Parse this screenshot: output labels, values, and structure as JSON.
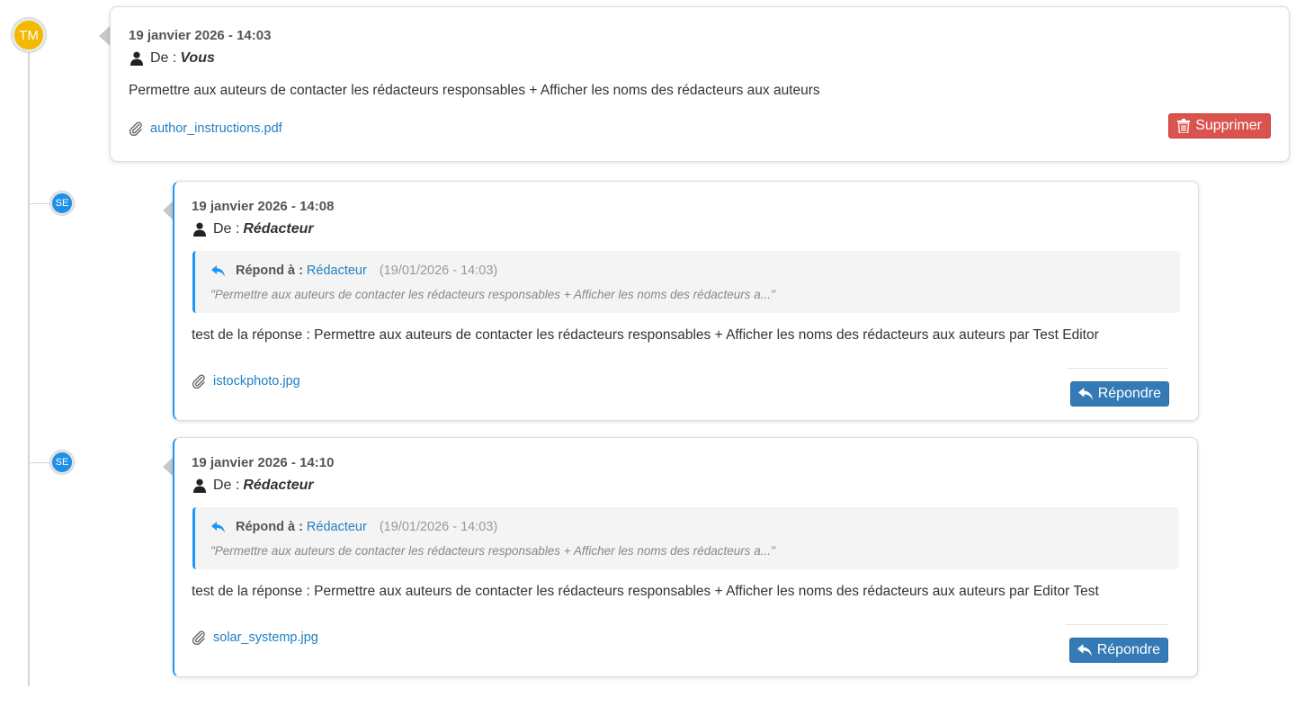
{
  "thread": {
    "main": {
      "avatar_initials": "TM",
      "date": "19 janvier 2026 - 14:03",
      "from_label": "De :",
      "from_name": "Vous",
      "message": "Permettre aux auteurs de contacter les rédacteurs responsables + Afficher les noms des rédacteurs aux auteurs",
      "attachment": "author_instructions.pdf",
      "delete_label": "Supprimer"
    },
    "replies": [
      {
        "avatar_initials": "SE",
        "date": "19 janvier 2026 - 14:08",
        "from_label": "De :",
        "from_name": "Rédacteur",
        "quote_label": "Répond à :",
        "quote_author": "Rédacteur",
        "quote_date": "(19/01/2026 - 14:03)",
        "quote_text": "\"Permettre aux auteurs de contacter les rédacteurs responsables + Afficher les noms des rédacteurs a...\"",
        "message": "test de la réponse : Permettre aux auteurs de contacter les rédacteurs responsables + Afficher les noms des rédacteurs aux auteurs par Test Editor",
        "attachment": "istockphoto.jpg",
        "reply_label": "Répondre"
      },
      {
        "avatar_initials": "SE",
        "date": "19 janvier 2026 - 14:10",
        "from_label": "De :",
        "from_name": "Rédacteur",
        "quote_label": "Répond à :",
        "quote_author": "Rédacteur",
        "quote_date": "(19/01/2026 - 14:03)",
        "quote_text": "\"Permettre aux auteurs de contacter les rédacteurs responsables + Afficher les noms des rédacteurs a...\"",
        "message": "test de la réponse : Permettre aux auteurs de contacter les rédacteurs responsables + Afficher les noms des rédacteurs aux auteurs par Editor Test",
        "attachment": "solar_systemp.jpg",
        "reply_label": "Répondre"
      }
    ]
  },
  "colors": {
    "accent": "#2196f3",
    "link": "#2280c3",
    "main_avatar": "#f5b800",
    "reply_avatar": "#1e90e8",
    "danger": "#d9534f",
    "primary": "#337ab7"
  },
  "icons": {
    "from": "user-icon",
    "attachment": "paperclip-icon",
    "delete": "trash-icon",
    "reply": "reply-arrow-icon"
  }
}
